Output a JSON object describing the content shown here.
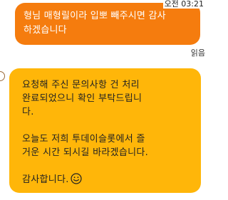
{
  "header": {
    "time": "오전 03:21"
  },
  "outgoing_message": {
    "text": "형님 매형릴이라 입뽀 빼주시면 감사\n하겠습니다",
    "status": "읽음"
  },
  "incoming_message": {
    "paragraph1": "요청해 주신 문의사항 건 처리\n완료되었으니 확인 부탁드립니\n다.",
    "paragraph2": "오늘도 저희 투데이슬롯에서 즐\n거운 시간 되시길 바라겠습니다.",
    "paragraph3": "감사합니다.",
    "emoji": "smiley-face-icon"
  },
  "colors": {
    "outgoing_bubble": "#F57C0E",
    "incoming_bubble": "#FFB609"
  }
}
